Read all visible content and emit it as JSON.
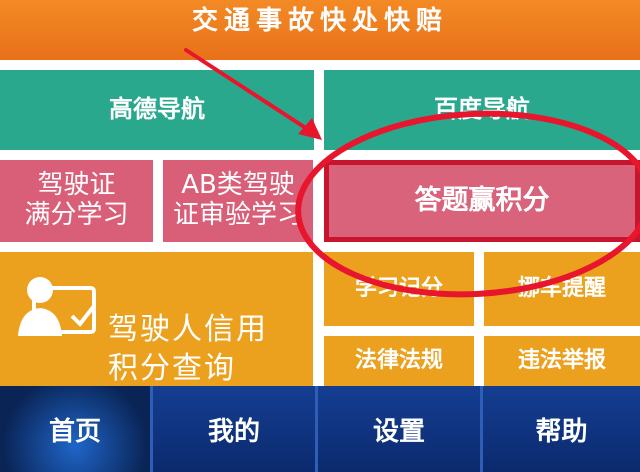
{
  "header": {
    "title": "交通事故快处快赔"
  },
  "navigation": {
    "gaode": "高德导航",
    "baidu": "百度导航"
  },
  "tiles": {
    "study_full": [
      "驾驶证",
      "满分学习"
    ],
    "study_ab": [
      "AB类驾驶",
      "证审验学习"
    ],
    "quiz": "答题赢积分",
    "credit": [
      "驾驶人信用",
      "积分查询"
    ],
    "learn_points": "学习记分",
    "move_car": "挪车提醒",
    "laws": "法律法规",
    "report": "违法举报"
  },
  "bottom_nav": {
    "home": "首页",
    "mine": "我的",
    "settings": "设置",
    "help": "帮助"
  },
  "colors": {
    "banner": "#ee7d20",
    "teal": "#2aa88e",
    "pink": "#d95f79",
    "orange": "#eba01e",
    "highlight_red": "#e8162c",
    "bottom_bar": "#0c2f78"
  },
  "icons": {
    "credit": "user-id-card-icon",
    "annotation": "red-arrow-and-circle"
  }
}
